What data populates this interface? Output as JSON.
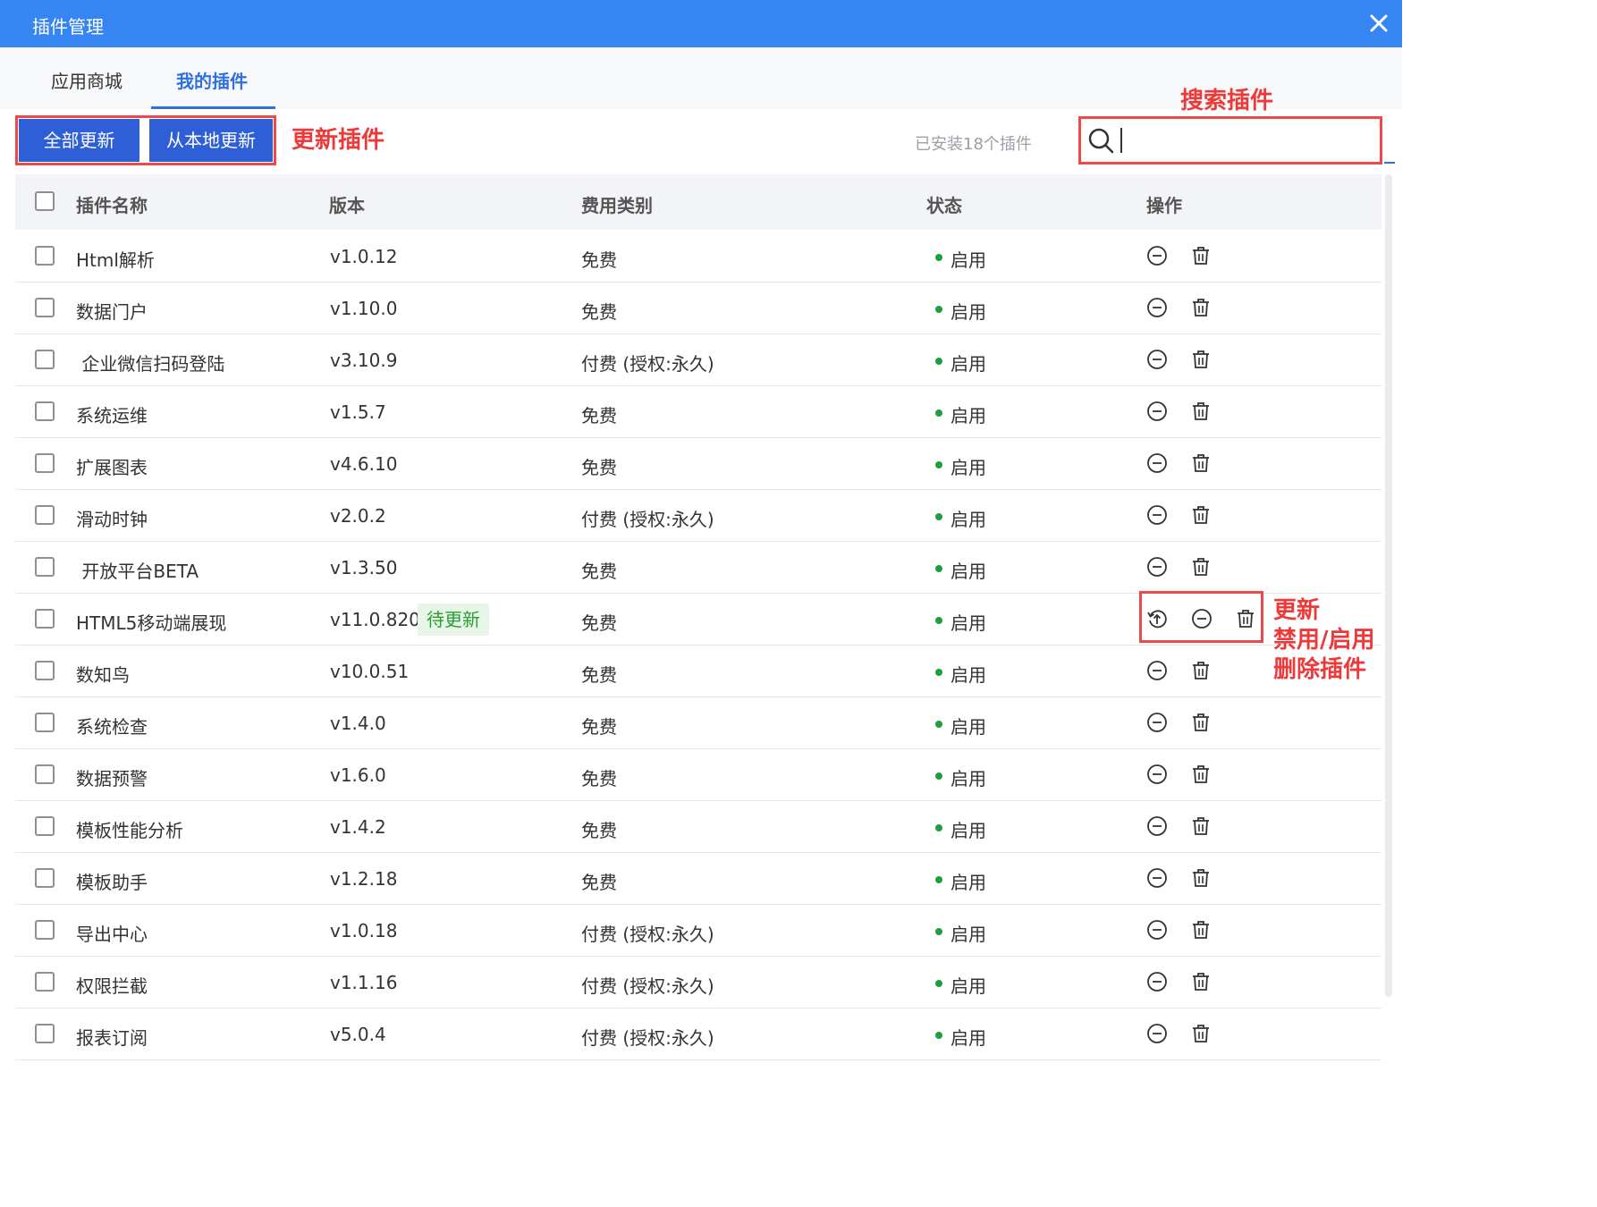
{
  "dialog": {
    "title": "插件管理"
  },
  "tabs": [
    {
      "label": "应用商城",
      "active": false
    },
    {
      "label": "我的插件",
      "active": true
    }
  ],
  "toolbar": {
    "update_all_label": "全部更新",
    "update_local_label": "从本地更新",
    "installed_text": "已安装18个插件",
    "search_placeholder": ""
  },
  "annotations": {
    "update_plugins": "更新插件",
    "search_plugins": "搜索插件",
    "actions_line1": "更新",
    "actions_line2": "禁用/启用",
    "actions_line3": "删除插件"
  },
  "table": {
    "columns": [
      "插件名称",
      "版本",
      "费用类别",
      "状态",
      "操作"
    ],
    "rows": [
      {
        "name": "Html解析",
        "version": "v1.0.12",
        "fee": "免费",
        "status": "启用"
      },
      {
        "name": "数据门户",
        "version": "v1.10.0",
        "fee": "免费",
        "status": "启用"
      },
      {
        "name": " 企业微信扫码登陆",
        "version": "v3.10.9",
        "fee": "付费 (授权:永久)",
        "status": "启用"
      },
      {
        "name": "系统运维",
        "version": "v1.5.7",
        "fee": "免费",
        "status": "启用"
      },
      {
        "name": "扩展图表",
        "version": "v4.6.10",
        "fee": "免费",
        "status": "启用"
      },
      {
        "name": "滑动时钟",
        "version": "v2.0.2",
        "fee": "付费 (授权:永久)",
        "status": "启用"
      },
      {
        "name": " 开放平台BETA",
        "version": "v1.3.50",
        "fee": "免费",
        "status": "启用"
      },
      {
        "name": "HTML5移动端展现",
        "version": "v11.0.820",
        "badge": "待更新",
        "fee": "免费",
        "status": "启用"
      },
      {
        "name": "数知鸟",
        "version": "v10.0.51",
        "fee": "免费",
        "status": "启用"
      },
      {
        "name": "系统检查",
        "version": "v1.4.0",
        "fee": "免费",
        "status": "启用"
      },
      {
        "name": "数据预警",
        "version": "v1.6.0",
        "fee": "免费",
        "status": "启用"
      },
      {
        "name": "模板性能分析",
        "version": "v1.4.2",
        "fee": "免费",
        "status": "启用"
      },
      {
        "name": "模板助手",
        "version": "v1.2.18",
        "fee": "免费",
        "status": "启用"
      },
      {
        "name": "导出中心",
        "version": "v1.0.18",
        "fee": "付费 (授权:永久)",
        "status": "启用"
      },
      {
        "name": "权限拦截",
        "version": "v1.1.16",
        "fee": "付费 (授权:永久)",
        "status": "启用"
      },
      {
        "name": "报表订阅",
        "version": "v5.0.4",
        "fee": "付费 (授权:永久)",
        "status": "启用"
      }
    ]
  },
  "icons": [
    "close-icon",
    "search-icon",
    "update-icon",
    "disable-icon",
    "delete-icon"
  ],
  "colors": {
    "titlebar": "#3685f2",
    "button": "#2f5fd6",
    "annotation": "#ec4a4a",
    "status_dot": "#1e9e3c"
  }
}
